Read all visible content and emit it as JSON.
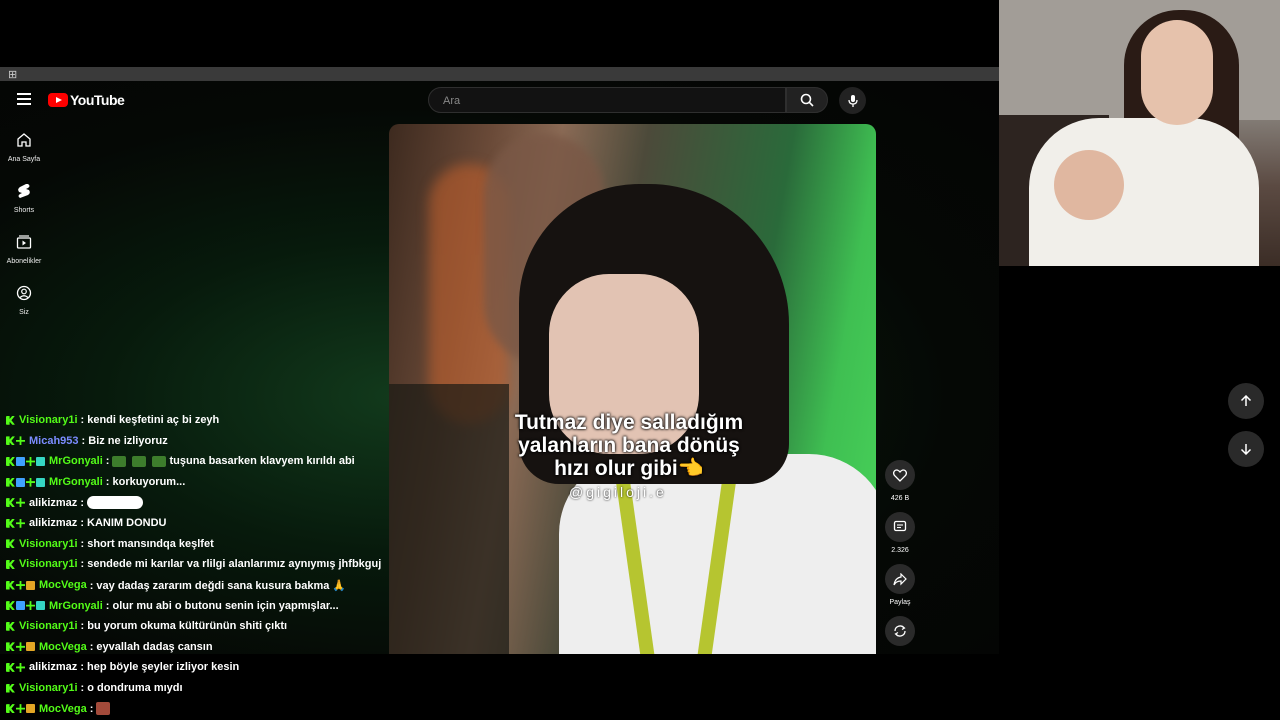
{
  "youtube": {
    "logo_text": "YouTube",
    "search_placeholder": "Ara",
    "nav": [
      {
        "label": "Ana Sayfa",
        "icon": "home-icon"
      },
      {
        "label": "Shorts",
        "icon": "shorts-icon"
      },
      {
        "label": "Abonelikler",
        "icon": "subscriptions-icon"
      },
      {
        "label": "Siz",
        "icon": "you-icon"
      }
    ],
    "video": {
      "caption_line1": "Tutmaz diye salladığım",
      "caption_line2": "yalanların bana dönüş",
      "caption_line3": "hızı olur gibi",
      "watermark": "@gigiloji.e"
    },
    "actions": {
      "likes": "426 B",
      "comments": "2.326",
      "share": "Paylaş"
    }
  },
  "chat": [
    {
      "user": "Visionary1i",
      "color": "#53fc18",
      "badges": [
        "k"
      ],
      "text": ": kendi keşfetini aç bi zeyh"
    },
    {
      "user": "Micah953",
      "color": "#7b8cff",
      "badges": [
        "k",
        "g"
      ],
      "text": ": Biz ne izliyoruz"
    },
    {
      "user": "MrGonyali",
      "color": "#53fc18",
      "badges": [
        "k",
        "bl",
        "g",
        "te"
      ],
      "text": ":",
      "emotes": 3,
      "text2": "tuşuna basarken klavyem kırıldı abi"
    },
    {
      "user": "MrGonyali",
      "color": "#53fc18",
      "badges": [
        "k",
        "bl",
        "g",
        "te"
      ],
      "text": ": korkuyorum..."
    },
    {
      "user": "alikizmaz",
      "color": "#ffffff",
      "badges": [
        "k",
        "g"
      ],
      "text": ":",
      "wide_emote": true
    },
    {
      "user": "alikizmaz",
      "color": "#ffffff",
      "badges": [
        "k",
        "g"
      ],
      "text": ": KANIM DONDU"
    },
    {
      "user": "Visionary1i",
      "color": "#53fc18",
      "badges": [
        "k"
      ],
      "text": ": short mansındqa keşlfet"
    },
    {
      "user": "Visionary1i",
      "color": "#53fc18",
      "badges": [
        "k"
      ],
      "text": ": sendede mi karılar va rlilgi alanlarımız aynıymış jhfbkguj"
    },
    {
      "user": "MocVega",
      "color": "#53fc18",
      "badges": [
        "k",
        "g",
        "yl"
      ],
      "text": ": vay dadaş zararım değdi sana kusura bakma 🙏"
    },
    {
      "user": "MrGonyali",
      "color": "#53fc18",
      "badges": [
        "k",
        "bl",
        "g",
        "te"
      ],
      "text": ": olur mu abi o butonu senin için yapmışlar..."
    },
    {
      "user": "Visionary1i",
      "color": "#53fc18",
      "badges": [
        "k"
      ],
      "text": ": bu yorum okuma kültürünün shiti çıktı"
    },
    {
      "user": "MocVega",
      "color": "#53fc18",
      "badges": [
        "k",
        "g",
        "yl"
      ],
      "text": ": eyvallah dadaş cansın"
    },
    {
      "user": "alikizmaz",
      "color": "#ffffff",
      "badges": [
        "k",
        "g"
      ],
      "text": ": hep böyle şeyler izliyor kesin"
    },
    {
      "user": "Visionary1i",
      "color": "#53fc18",
      "badges": [
        "k"
      ],
      "text": ": o dondruma mıydı"
    },
    {
      "user": "MocVega",
      "color": "#53fc18",
      "badges": [
        "k",
        "g",
        "yl"
      ],
      "text": ":",
      "red_emote": true
    }
  ]
}
